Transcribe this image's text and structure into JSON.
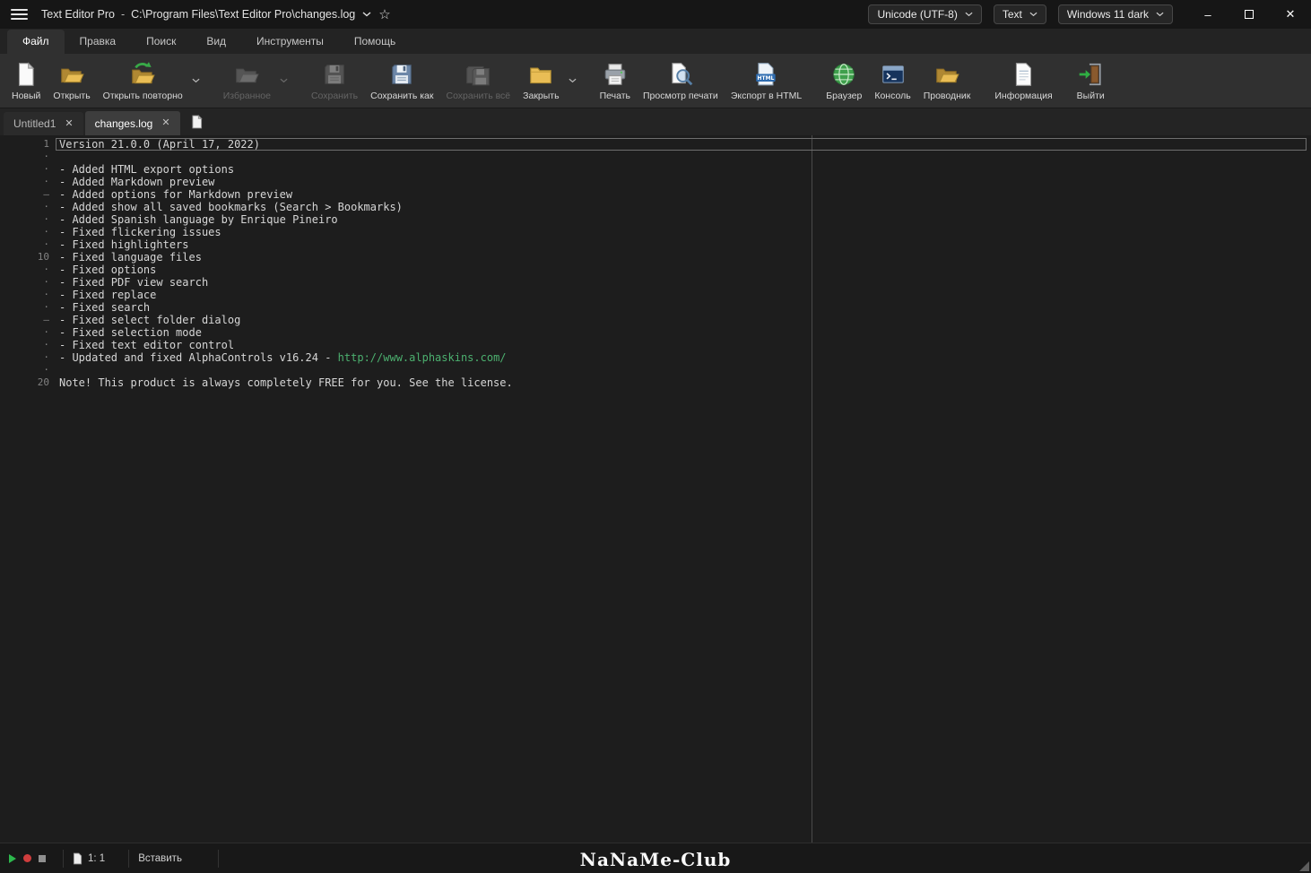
{
  "title_bar": {
    "app_title": "Text Editor Pro",
    "separator": "-",
    "file_path": "C:\\Program Files\\Text Editor Pro\\changes.log",
    "encoding_select": "Unicode (UTF-8)",
    "filetype_select": "Text",
    "theme_select": "Windows 11 dark"
  },
  "icons": {
    "minimize": "–",
    "close": "✕",
    "star": "☆",
    "tab_close": "✕"
  },
  "menu": {
    "tabs": [
      {
        "label": "Файл",
        "active": true
      },
      {
        "label": "Правка",
        "active": false
      },
      {
        "label": "Поиск",
        "active": false
      },
      {
        "label": "Вид",
        "active": false
      },
      {
        "label": "Инструменты",
        "active": false
      },
      {
        "label": "Помощь",
        "active": false
      }
    ]
  },
  "toolbar": {
    "items": [
      {
        "id": "new",
        "label": "Новый",
        "icon": "doc-new",
        "enabled": true,
        "dropdown": false,
        "gap_after": false
      },
      {
        "id": "open",
        "label": "Открыть",
        "icon": "folder-open",
        "enabled": true,
        "dropdown": false,
        "gap_after": false
      },
      {
        "id": "reopen",
        "label": "Открыть повторно",
        "icon": "folder-reopen",
        "enabled": true,
        "dropdown": true,
        "gap_after": true
      },
      {
        "id": "favorites",
        "label": "Избранное",
        "icon": "folder-favorites",
        "enabled": false,
        "dropdown": true,
        "gap_after": true
      },
      {
        "id": "save",
        "label": "Сохранить",
        "icon": "floppy-save",
        "enabled": false,
        "dropdown": false,
        "gap_after": false
      },
      {
        "id": "save-as",
        "label": "Сохранить как",
        "icon": "floppy-save-as",
        "enabled": true,
        "dropdown": false,
        "gap_after": false
      },
      {
        "id": "save-all",
        "label": "Сохранить всё",
        "icon": "floppy-save-all",
        "enabled": false,
        "dropdown": false,
        "gap_after": false
      },
      {
        "id": "close",
        "label": "Закрыть",
        "icon": "folder-close",
        "enabled": true,
        "dropdown": true,
        "gap_after": true
      },
      {
        "id": "print",
        "label": "Печать",
        "icon": "printer",
        "enabled": true,
        "dropdown": false,
        "gap_after": false
      },
      {
        "id": "print-preview",
        "label": "Просмотр печати",
        "icon": "print-preview",
        "enabled": true,
        "dropdown": false,
        "gap_after": false
      },
      {
        "id": "export-html",
        "label": "Экспорт в HTML",
        "icon": "html-export",
        "enabled": true,
        "dropdown": false,
        "gap_after": true
      },
      {
        "id": "browser",
        "label": "Браузер",
        "icon": "globe",
        "enabled": true,
        "dropdown": false,
        "gap_after": false
      },
      {
        "id": "console",
        "label": "Консоль",
        "icon": "console-window",
        "enabled": true,
        "dropdown": false,
        "gap_after": false
      },
      {
        "id": "explorer",
        "label": "Проводник",
        "icon": "folder-explorer",
        "enabled": true,
        "dropdown": false,
        "gap_after": true
      },
      {
        "id": "info",
        "label": "Информация",
        "icon": "info-document",
        "enabled": true,
        "dropdown": false,
        "gap_after": true
      },
      {
        "id": "exit",
        "label": "Выйти",
        "icon": "exit-door",
        "enabled": true,
        "dropdown": false,
        "gap_after": false
      }
    ]
  },
  "doc_tabs": [
    {
      "label": "Untitled1",
      "active": false
    },
    {
      "label": "changes.log",
      "active": true
    }
  ],
  "editor": {
    "lines": [
      {
        "gutter": "1",
        "text": "Version 21.0.0 (April 17, 2022)",
        "current": true
      },
      {
        "gutter": "·",
        "text": ""
      },
      {
        "gutter": "·",
        "text": "- Added HTML export options"
      },
      {
        "gutter": "·",
        "text": "- Added Markdown preview"
      },
      {
        "gutter": "–",
        "text": "- Added options for Markdown preview"
      },
      {
        "gutter": "·",
        "text": "- Added show all saved bookmarks (Search > Bookmarks)"
      },
      {
        "gutter": "·",
        "text": "- Added Spanish language by Enrique Pineiro"
      },
      {
        "gutter": "·",
        "text": "- Fixed flickering issues"
      },
      {
        "gutter": "·",
        "text": "- Fixed highlighters"
      },
      {
        "gutter": "10",
        "text": "- Fixed language files"
      },
      {
        "gutter": "·",
        "text": "- Fixed options"
      },
      {
        "gutter": "·",
        "text": "- Fixed PDF view search"
      },
      {
        "gutter": "·",
        "text": "- Fixed replace"
      },
      {
        "gutter": "·",
        "text": "- Fixed search"
      },
      {
        "gutter": "–",
        "text": "- Fixed select folder dialog"
      },
      {
        "gutter": "·",
        "text": "- Fixed selection mode"
      },
      {
        "gutter": "·",
        "text": "- Fixed text editor control"
      },
      {
        "gutter": "·",
        "text": "- Updated and fixed AlphaControls v16.24 - ",
        "link": "http://www.alphaskins.com/"
      },
      {
        "gutter": "·",
        "text": ""
      },
      {
        "gutter": "20",
        "text": "Note! This product is always completely FREE for you. See the license."
      }
    ]
  },
  "status_bar": {
    "caret_position": "1: 1",
    "insert_mode": "Вставить"
  },
  "watermark": "NaNaMe-Club",
  "colors": {
    "url_link": "#4cb06f",
    "folder_yellow": "#e9bd55",
    "run_green": "#2db84d",
    "record_red": "#cf3d3d",
    "margin_line": "#4a4a4a",
    "toolbar_bg": "#303030",
    "editor_bg": "#1d1d1d"
  }
}
